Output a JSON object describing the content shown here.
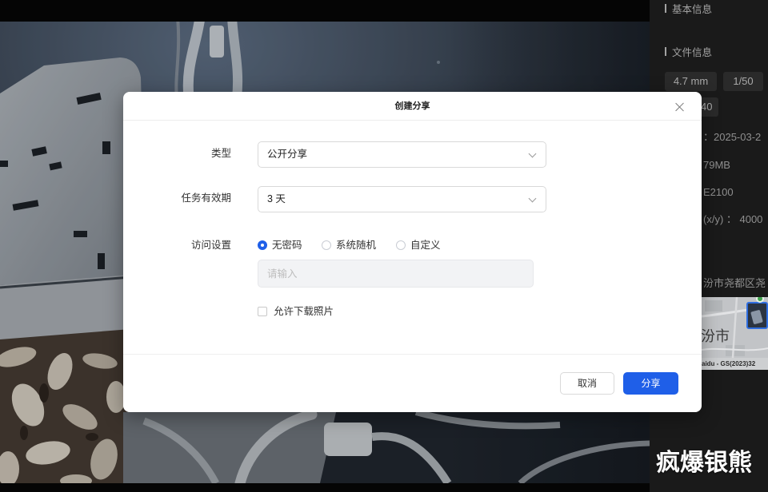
{
  "info_panel": {
    "basic_title": "基本信息",
    "file_title": "文件信息",
    "tags": [
      "4.7 mm",
      "1/50",
      "40"
    ],
    "rows": [
      "：2025-03-2",
      "79MB",
      "E2100",
      "(x/y) ： 4000"
    ],
    "location": "汾市尧都区尧",
    "map": {
      "city_label": "汾市",
      "attribution": "aidu - GS(2023)32",
      "marker_icon": "photo-marker-icon",
      "pin_icon": "map-pin-icon"
    }
  },
  "dialog": {
    "title": "创建分享",
    "close_icon": "close-icon",
    "type_field": {
      "label": "类型",
      "value": "公开分享",
      "icon": "chevron-down-icon"
    },
    "expiry_field": {
      "label": "任务有效期",
      "value": "3 天",
      "icon": "chevron-down-icon"
    },
    "access_field": {
      "label": "访问设置",
      "options": [
        {
          "label": "无密码",
          "selected": true
        },
        {
          "label": "系统随机",
          "selected": false
        },
        {
          "label": "自定义",
          "selected": false
        }
      ],
      "password_input": {
        "value": "",
        "placeholder": "请输入",
        "disabled": true
      }
    },
    "allow_download": {
      "label": "允许下载照片",
      "checked": false
    },
    "buttons": {
      "cancel": "取消",
      "share": "分享"
    }
  },
  "watermark": "疯爆银熊",
  "colors": {
    "primary": "#1f5fe8",
    "panel_bg": "#1a1a1a",
    "tag_bg": "#2a2a2a",
    "dialog_bg": "#ffffff",
    "input_disabled_bg": "#f2f3f5"
  }
}
